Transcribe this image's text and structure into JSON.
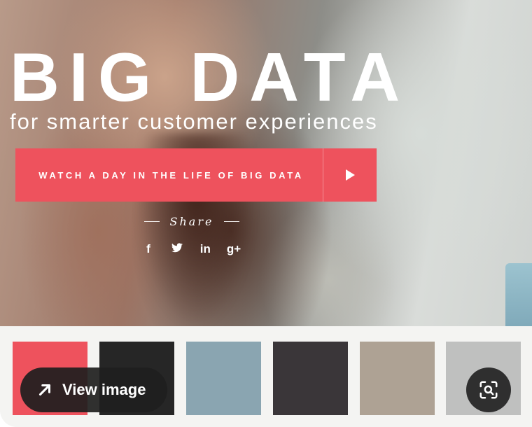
{
  "hero": {
    "title": "BIG DATA",
    "subtitle": "for smarter customer experiences",
    "cta_label": "WATCH A DAY IN THE LIFE OF BIG DATA",
    "cta_color": "#ee525d",
    "share_label": "Share",
    "social": [
      {
        "name": "facebook-icon",
        "glyph": "f"
      },
      {
        "name": "twitter-icon",
        "glyph": "🐦"
      },
      {
        "name": "linkedin-icon",
        "glyph": "in"
      },
      {
        "name": "google-plus-icon",
        "glyph": "g+"
      }
    ]
  },
  "palette": [
    "#ee525d",
    "#262626",
    "#8aa5b1",
    "#3a3639",
    "#aea294",
    "#bfc0bf"
  ],
  "overlay": {
    "view_image_label": "View image",
    "view_image_icon": "arrow-up-right-icon",
    "lens_icon": "visual-search-icon"
  }
}
